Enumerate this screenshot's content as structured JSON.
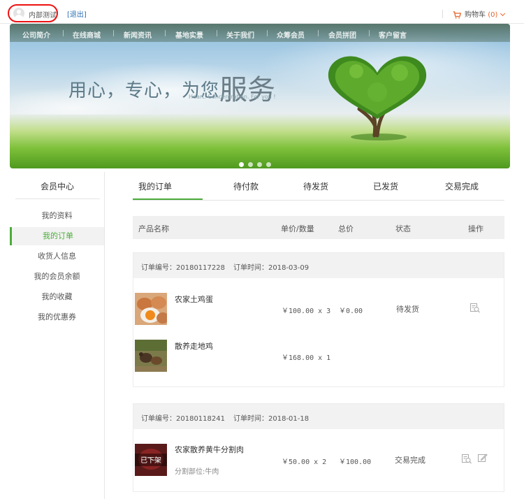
{
  "topbar": {
    "username": "内部测试",
    "logout": "[退出]",
    "cart_label": "购物车",
    "cart_count": "(0)"
  },
  "banner": {
    "nav": [
      "公司简介",
      "在线商城",
      "新闻资讯",
      "基地实景",
      "关于我们",
      "众筹会员",
      "会员拼团",
      "客户留言"
    ],
    "slogan_part1": "用心，专心，为您",
    "slogan_part2": "服务",
    "slogan_sub": "Heart. Concentration. For you !",
    "slide_count": 4,
    "active_slide": 1
  },
  "sidebar": {
    "title": "会员中心",
    "items": [
      "我的资料",
      "我的订单",
      "收货人信息",
      "我的会员余额",
      "我的收藏",
      "我的优惠券"
    ],
    "active_index": 1
  },
  "tabs": [
    "我的订单",
    "待付款",
    "待发货",
    "已发货",
    "交易完成"
  ],
  "active_tab": 0,
  "table_headers": {
    "name": "产品名称",
    "price_qty": "单价/数量",
    "total": "总价",
    "status": "状态",
    "actions": "操作"
  },
  "orders": [
    {
      "number_label": "订单编号：20180117228",
      "time_label": "订单时间：2018-03-09",
      "items": [
        {
          "name": "农家土鸡蛋",
          "price_qty": "￥100.00 x 3",
          "image": "eggs-photo"
        },
        {
          "name": "散养走地鸡",
          "price_qty": "￥168.00 x 1",
          "image": "chicken-photo"
        }
      ],
      "total": "￥0.00",
      "status": "待发货",
      "actions": [
        "view-order-icon"
      ]
    },
    {
      "number_label": "订单编号：20180118241",
      "time_label": "订单时间：2018-01-18",
      "items": [
        {
          "name": "农家散养黄牛分割肉",
          "sub": "分割部位:牛肉",
          "price_qty": "￥50.00 x 2",
          "image": "beef-photo",
          "overlay": "已下架"
        }
      ],
      "total": "￥100.00",
      "status": "交易完成",
      "actions": [
        "view-order-icon",
        "edit-review-icon"
      ]
    }
  ],
  "colors": {
    "accent": "#4cac3a",
    "cart": "#e4642a",
    "link": "#2a6fb5",
    "highlight_circle": "#e11111"
  }
}
